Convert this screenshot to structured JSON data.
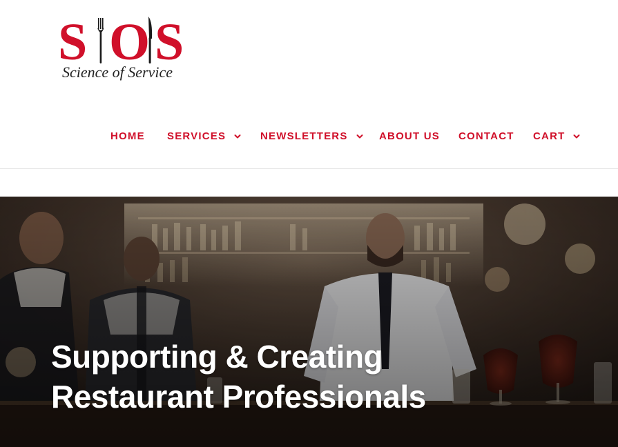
{
  "brand": {
    "logo_letters": [
      "S",
      "O",
      "S"
    ],
    "tagline": "Science of Service",
    "color": "#d0102a"
  },
  "nav": {
    "items": [
      {
        "label": "HOME",
        "has_dropdown": false
      },
      {
        "label": "SERVICES",
        "has_dropdown": true
      },
      {
        "label": "NEWSLETTERS",
        "has_dropdown": true
      },
      {
        "label": "ABOUT US",
        "has_dropdown": false
      },
      {
        "label": "CONTACT",
        "has_dropdown": false
      },
      {
        "label": "CART",
        "has_dropdown": true
      }
    ],
    "icon": "chevron-down-icon",
    "color": "#d0102a"
  },
  "hero": {
    "title_line1": "Supporting & Creating",
    "title_line2": "Restaurant Professionals",
    "background": "restaurant-bar-photo"
  }
}
